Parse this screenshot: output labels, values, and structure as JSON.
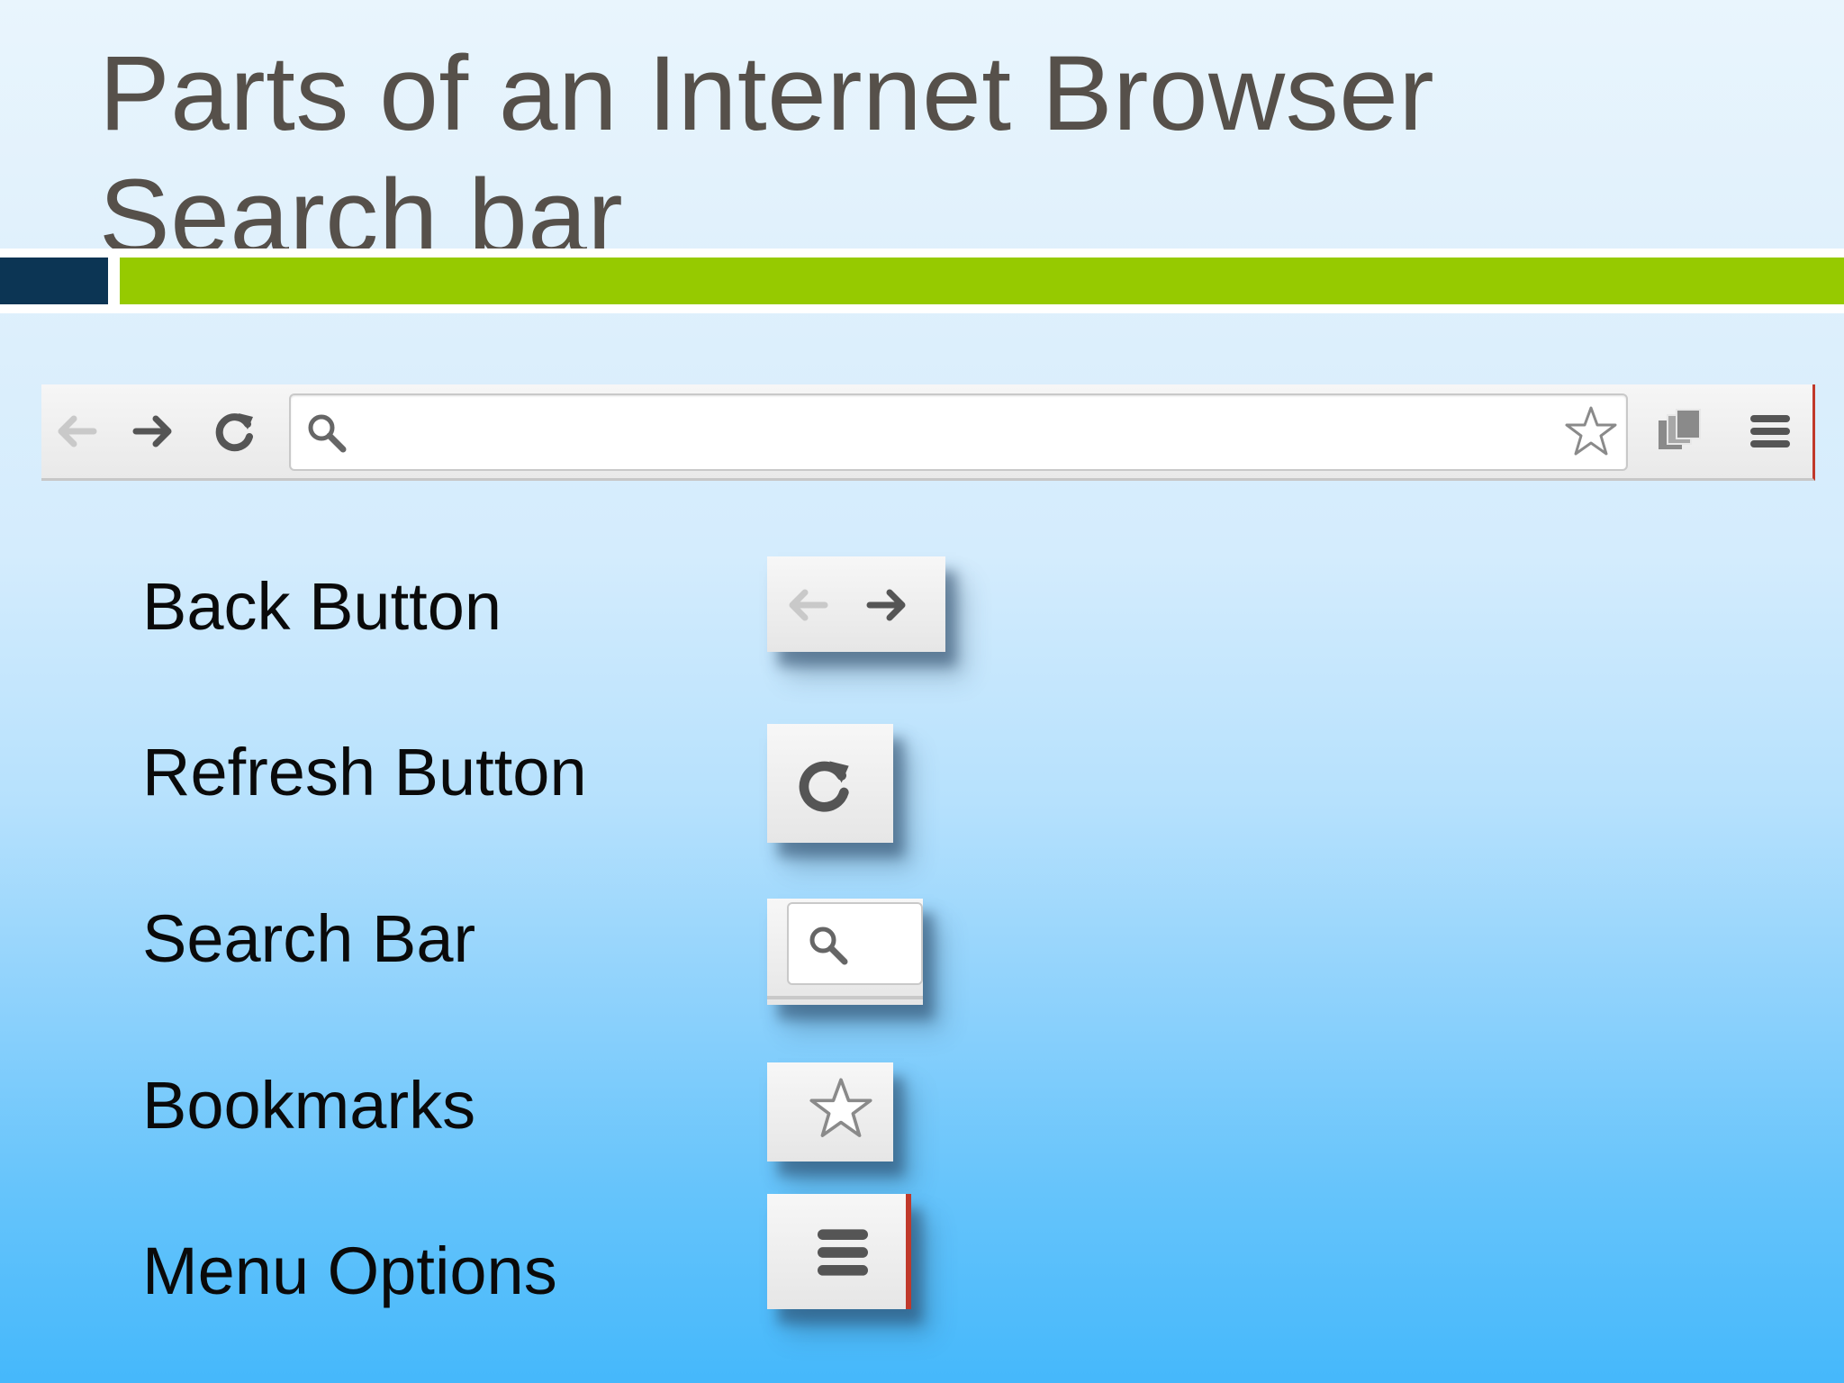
{
  "slide": {
    "title": "Parts of an Internet Browser Search bar"
  },
  "colors": {
    "title": "#56504a",
    "rule_navy": "#0c3554",
    "rule_green": "#96ca00",
    "menu_accent": "#c0392b"
  },
  "toolbar": {
    "icons": [
      "back-arrow-icon",
      "forward-arrow-icon",
      "reload-icon",
      "search-icon",
      "star-icon",
      "extensions-icon",
      "hamburger-menu-icon"
    ]
  },
  "legend": [
    {
      "label": "Back Button",
      "icon": "back-forward-icon"
    },
    {
      "label": "Refresh Button",
      "icon": "reload-icon"
    },
    {
      "label": "Search Bar",
      "icon": "search-icon"
    },
    {
      "label": "Bookmarks",
      "icon": "star-icon"
    },
    {
      "label": "Menu Options",
      "icon": "hamburger-menu-icon"
    }
  ]
}
